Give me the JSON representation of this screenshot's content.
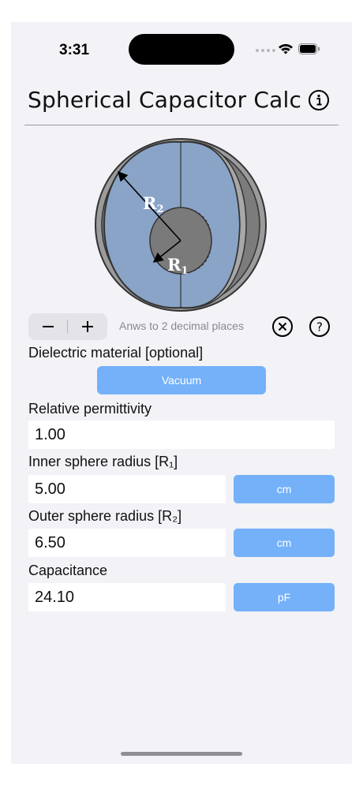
{
  "status_bar": {
    "time": "3:31"
  },
  "nav": {
    "title": "Spherical Capacitor Calc"
  },
  "diagram": {
    "outer_label": "R",
    "outer_sub": "2",
    "inner_label": "R",
    "inner_sub": "1"
  },
  "controls": {
    "decimal_label": "Anws to 2 decimal places"
  },
  "dielectric": {
    "label": "Dielectric material [optional]",
    "material": "Vacuum"
  },
  "permittivity": {
    "label": "Relative permittivity",
    "value": "1.00"
  },
  "inner_radius": {
    "label": "Inner sphere radius [R₁]",
    "value": "5.00",
    "unit": "cm"
  },
  "outer_radius": {
    "label": "Outer sphere radius [R₂]",
    "value": "6.50",
    "unit": "cm"
  },
  "capacitance": {
    "label": "Capacitance",
    "value": "24.10",
    "unit": "pF"
  },
  "colors": {
    "accent": "#74b1f9",
    "inner_fill": "#8aa4c8",
    "shell": "#9b9b9b",
    "background": "#f2f2f7"
  }
}
